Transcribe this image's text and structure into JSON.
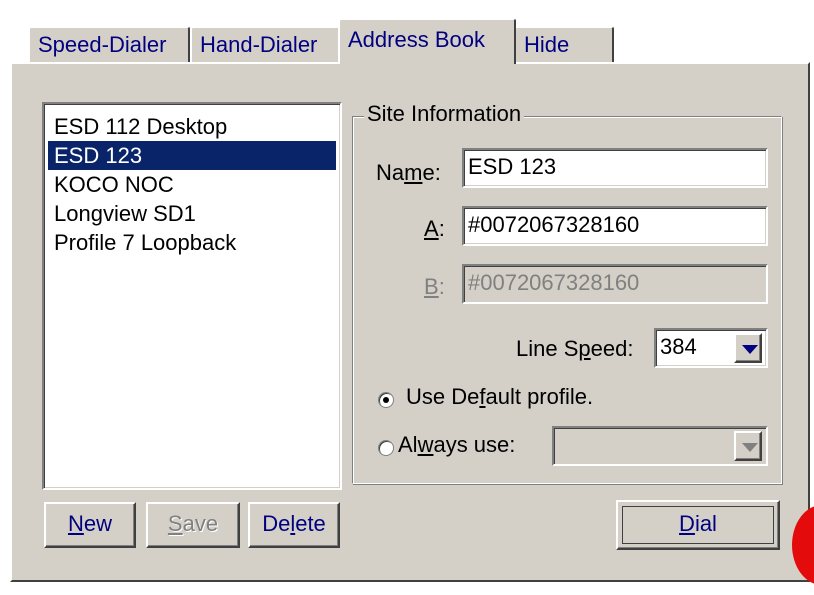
{
  "tabs": [
    {
      "label": "Speed-Dialer"
    },
    {
      "label": "Hand-Dialer"
    },
    {
      "label": "Address Book"
    },
    {
      "label": "Hide"
    }
  ],
  "address_list": {
    "items": [
      "ESD 112 Desktop",
      "ESD 123",
      "KOCO NOC",
      "Longview SD1",
      "Profile 7 Loopback"
    ],
    "selected_index": 1
  },
  "site_info": {
    "title": "Site Information",
    "name_label_pre": "Na",
    "name_label_accel": "m",
    "name_label_post": "e:",
    "name_value": "ESD 123",
    "a_label": "A",
    "a_colon": ":",
    "a_value": "#0072067328160",
    "b_label": "B",
    "b_colon": ":",
    "b_value": "#0072067328160",
    "line_speed_pre": "Line S",
    "line_speed_accel": "p",
    "line_speed_post": "eed:",
    "line_speed_value": "384",
    "use_default_pre": "Use De",
    "use_default_accel": "f",
    "use_default_post": "ault profile.",
    "always_use_pre": "Al",
    "always_use_accel": "w",
    "always_use_post": "ays use:",
    "always_use_value": ""
  },
  "buttons": {
    "new_accel": "N",
    "new_rest": "ew",
    "save_accel": "S",
    "save_rest": "ave",
    "delete_pre": "De",
    "delete_accel": "l",
    "delete_post": "ete",
    "dial_accel": "D",
    "dial_rest": "ial"
  },
  "colors": {
    "face": "#d4d0c8",
    "selection": "#0a246a",
    "label_blue": "#000080",
    "indicator": "#e30b0b"
  }
}
